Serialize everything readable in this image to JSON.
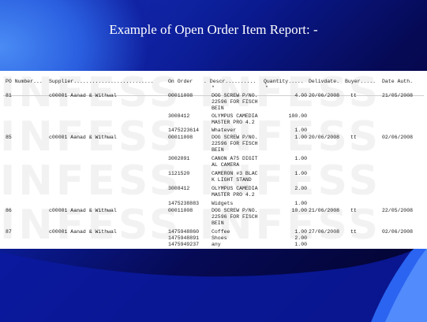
{
  "slide": {
    "title": "Example of Open Order Item Report: -"
  },
  "report": {
    "watermark": "INFESS INFESS INFESS",
    "headers": {
      "po": "PO Number...",
      "supplier": "Supplier..........................",
      "on_order": "On Order",
      "descr": ". Descr..........",
      "descr_marker": "*",
      "quantity": "Quantity.....",
      "quantity_marker": "*",
      "delivdate": "Delivdate.",
      "buyer": "Buyer.....",
      "date_auth": "Date Auth."
    },
    "rows": [
      {
        "po": "81",
        "supplier": "c00001 Aanad & Withwal",
        "on_order": "00011008",
        "descr": "DOG SCREW P/NO. 22596 FOR FISCH BEIN",
        "quantity": "4.00",
        "delivdate": "20/06/2008",
        "buyer": "tt",
        "date_auth": "21/05/2008"
      },
      {
        "po": "",
        "supplier": "",
        "on_order": "3008412",
        "descr": "OLYMPUS CAMEDIA MASTER PRO 4.2",
        "quantity": "100.00",
        "delivdate": "",
        "buyer": "",
        "date_auth": ""
      },
      {
        "po": "",
        "supplier": "",
        "on_order": "1475223614",
        "descr": "Whatever",
        "quantity": "1.00",
        "delivdate": "",
        "buyer": "",
        "date_auth": ""
      },
      {
        "po": "85",
        "supplier": "c00001 Aanad & Withwal",
        "on_order": "00011008",
        "descr": "DOG SCREW P/NO. 22596 FOR FISCH BEIN",
        "quantity": "1.00",
        "delivdate": "20/06/2008",
        "buyer": "tt",
        "date_auth": "02/06/2008"
      },
      {
        "po": "",
        "supplier": "",
        "on_order": "3002091",
        "descr": "CANON A75 DIGIT AL CAMERA",
        "quantity": "1.00",
        "delivdate": "",
        "buyer": "",
        "date_auth": ""
      },
      {
        "po": "",
        "supplier": "",
        "on_order": "1121520",
        "descr": "CAMERON #3 BLAC K LIGHT STAND",
        "quantity": "1.00",
        "delivdate": "",
        "buyer": "",
        "date_auth": ""
      },
      {
        "po": "",
        "supplier": "",
        "on_order": "3008412",
        "descr": "OLYMPUS CAMEDIA MASTER PRO 4.2",
        "quantity": "2.00",
        "delivdate": "",
        "buyer": "",
        "date_auth": ""
      },
      {
        "po": "",
        "supplier": "",
        "on_order": "1475238883",
        "descr": "Widgets",
        "quantity": "1.00",
        "delivdate": "",
        "buyer": "",
        "date_auth": ""
      },
      {
        "po": "86",
        "supplier": "c00001 Aanad & Withwal",
        "on_order": "00011008",
        "descr": "DOG SCREW P/NO. 22596 FOR FISCH BEIN",
        "quantity": "10.00",
        "delivdate": "21/06/2008",
        "buyer": "tt",
        "date_auth": "22/05/2008"
      },
      {
        "po": "87",
        "supplier": "c00001 Aanad & Withwal",
        "on_order": "1475948860",
        "descr": "Coffee",
        "quantity": "1.00",
        "delivdate": "27/06/2008",
        "buyer": "tt",
        "date_auth": "02/06/2008"
      },
      {
        "po": "",
        "supplier": "",
        "on_order": "1475948891",
        "descr": "Shoes",
        "quantity": "2.00",
        "delivdate": "",
        "buyer": "",
        "date_auth": ""
      },
      {
        "po": "",
        "supplier": "",
        "on_order": "1475949237",
        "descr": "any",
        "quantity": "1.00",
        "delivdate": "",
        "buyer": "",
        "date_auth": ""
      }
    ]
  }
}
